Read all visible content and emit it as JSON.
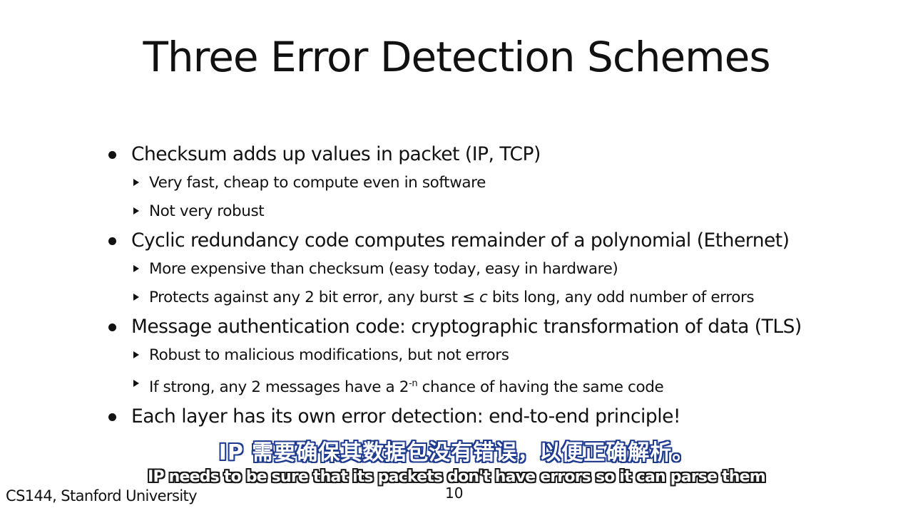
{
  "slide": {
    "title": "Three Error Detection Schemes",
    "bullets": [
      {
        "text": "Checksum adds up values in packet (IP, TCP)",
        "subs": [
          "Very fast, cheap to compute even in software",
          "Not very robust"
        ]
      },
      {
        "text": "Cyclic redundancy code computes remainder of a polynomial (Ethernet)",
        "subs": [
          "More expensive than checksum (easy today, easy in hardware)"
        ],
        "sub_crc": {
          "before": "Protects against any 2 bit error, any burst ",
          "symbol": "≤",
          "var": "c",
          "after": " bits long, any odd number of errors"
        }
      },
      {
        "text": "Message authentication code: cryptographic transformation of data (TLS)",
        "subs": [
          "Robust to malicious modifications, but not errors"
        ],
        "sub_mac": {
          "before": "If strong, any 2 messages have a 2",
          "exp": "-n",
          "after": " chance of having the same code"
        }
      },
      {
        "text": "Each layer has its own error detection: end-to-end principle!"
      }
    ],
    "footer": "CS144, Stanford University",
    "page_number": "10"
  },
  "subtitles": {
    "chinese": "IP 需要确保其数据包没有错误，以便正确解析。",
    "english": "IP needs to be sure that its packets don't have errors so it can parse them"
  }
}
